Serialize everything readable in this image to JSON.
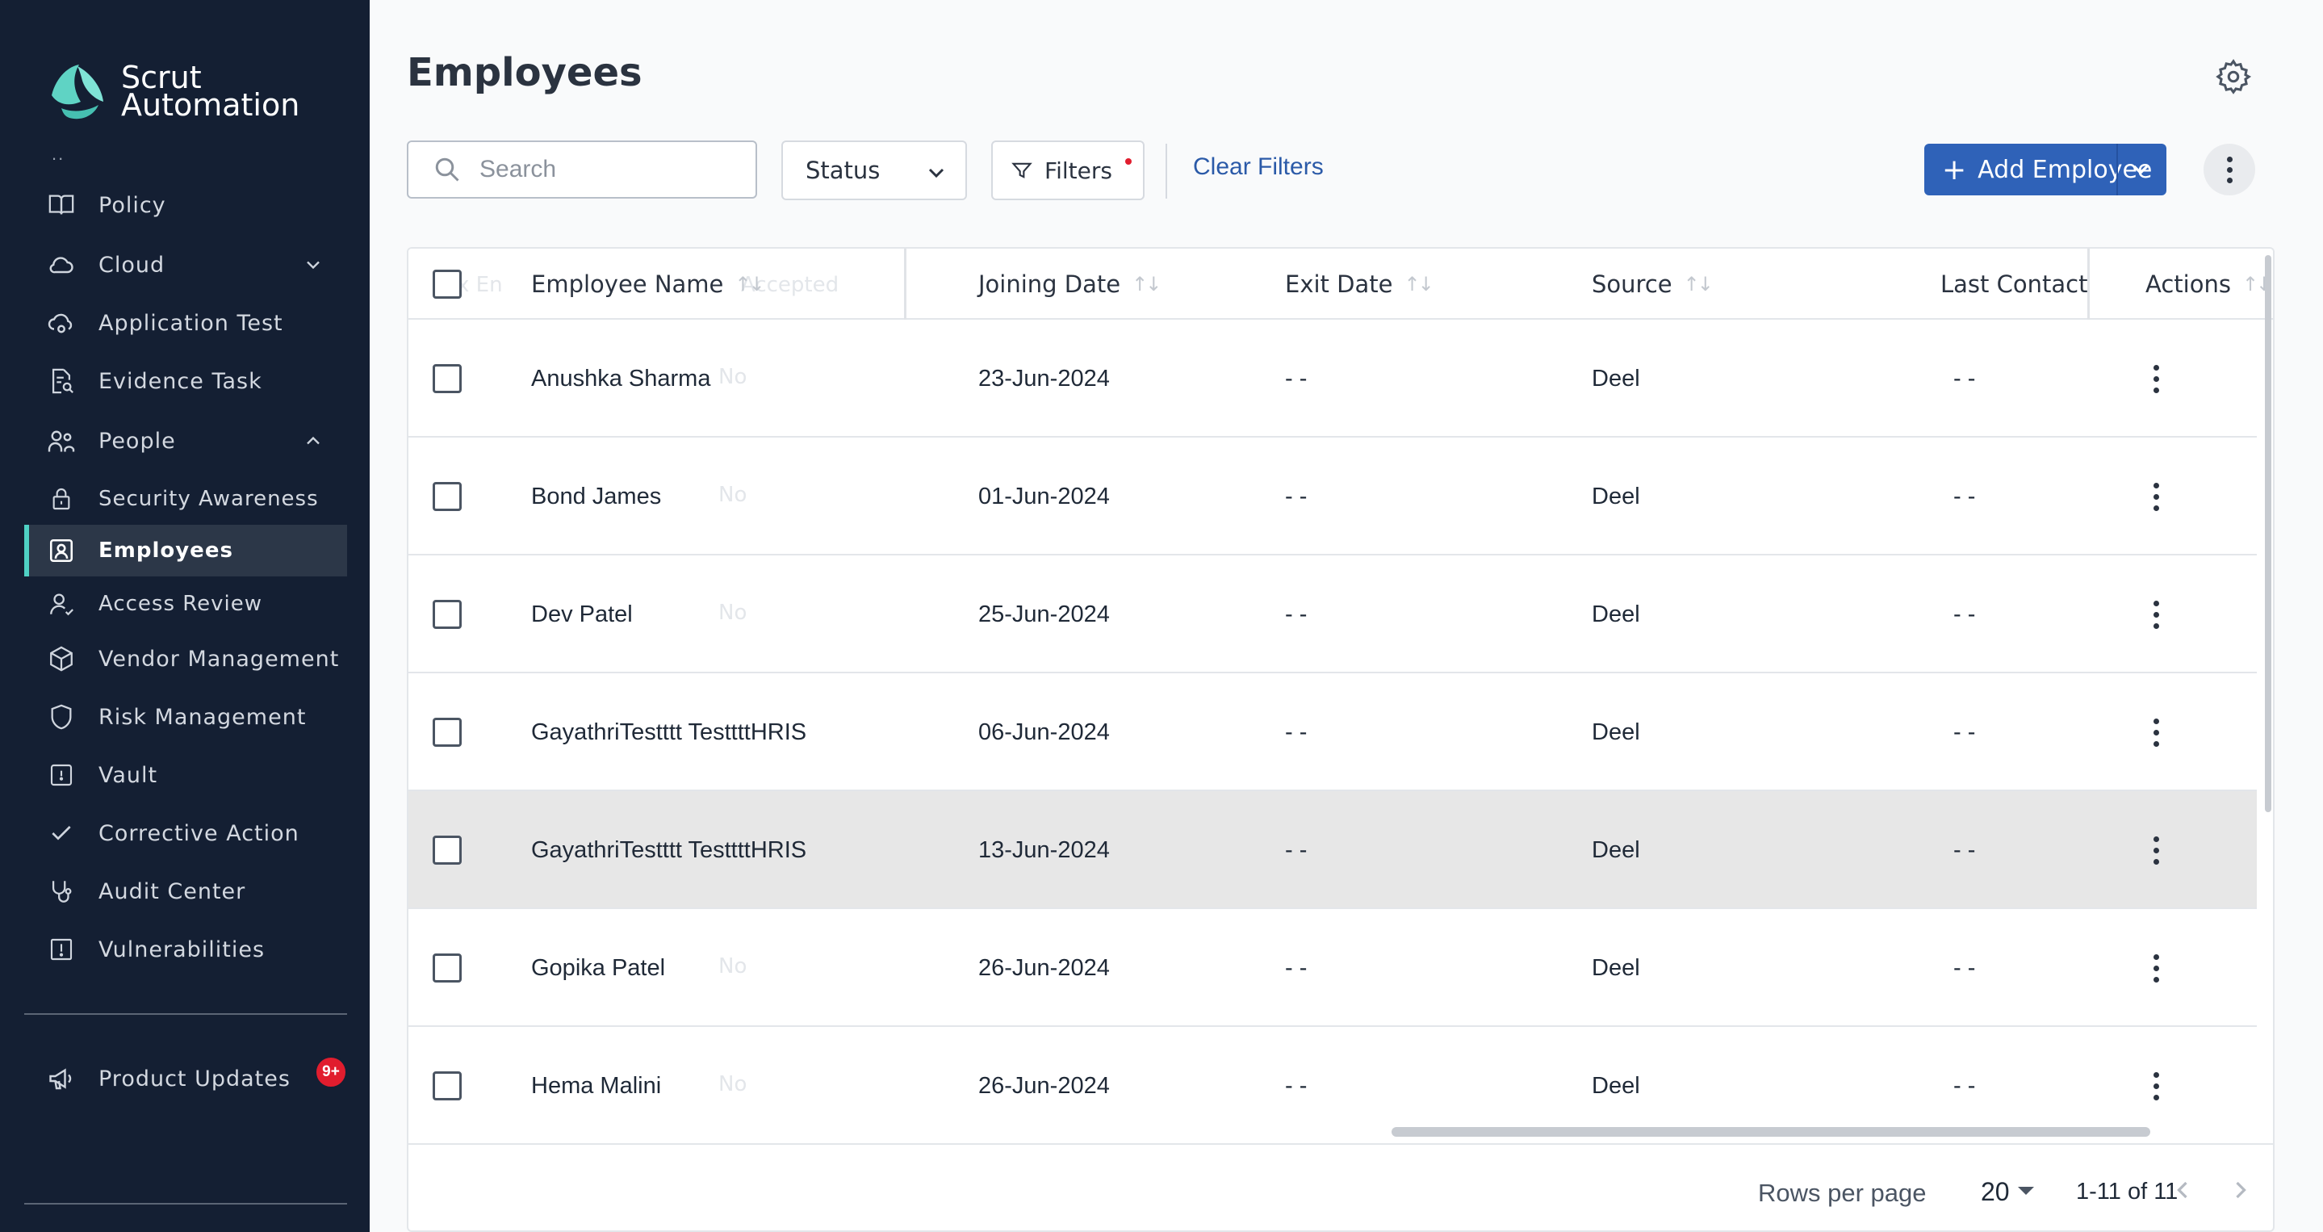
{
  "brand": {
    "line1": "Scrut",
    "line2": "Automation",
    "accent": "#4fd1c5"
  },
  "sidebar": {
    "ellipsis": "..",
    "items": [
      {
        "label": "Policy",
        "icon": "book-icon"
      },
      {
        "label": "Cloud",
        "icon": "cloud-icon",
        "expand": "chevron-down"
      },
      {
        "label": "Application Test",
        "icon": "cloud-gear-icon"
      },
      {
        "label": "Evidence Task",
        "icon": "document-search-icon"
      },
      {
        "label": "People",
        "icon": "people-icon",
        "expand": "chevron-up"
      },
      {
        "label": "Security Awareness",
        "icon": "lock-icon"
      },
      {
        "label": "Employees",
        "icon": "user-badge-icon",
        "active": true
      },
      {
        "label": "Access Review",
        "icon": "user-check-icon"
      },
      {
        "label": "Vendor Management",
        "icon": "cube-icon"
      },
      {
        "label": "Risk Management",
        "icon": "shield-icon"
      },
      {
        "label": "Vault",
        "icon": "vault-icon"
      },
      {
        "label": "Corrective Action",
        "icon": "check-icon"
      },
      {
        "label": "Audit Center",
        "icon": "stethoscope-icon"
      },
      {
        "label": "Vulnerabilities",
        "icon": "alert-square-icon"
      }
    ],
    "product_updates": {
      "label": "Product Updates",
      "badge": "9+"
    }
  },
  "page": {
    "title": "Employees",
    "search_placeholder": "Search",
    "status_label": "Status",
    "filters_label": "Filters",
    "clear_filters": "Clear Filters",
    "add_employee": "Add Employee"
  },
  "table": {
    "columns": {
      "name": "Employee Name",
      "joining": "Joining Date",
      "exit": "Exit Date",
      "source": "Source",
      "last_contact": "Last Contact",
      "actions": "Actions"
    },
    "ghost_header": "Accepted",
    "rows": [
      {
        "name": "Anushka Sharma",
        "joining": "23-Jun-2024",
        "exit": "- -",
        "source": "Deel",
        "last_contact": "- -",
        "ghost": "No"
      },
      {
        "name": "Bond James",
        "joining": "01-Jun-2024",
        "exit": "- -",
        "source": "Deel",
        "last_contact": "- -",
        "ghost": "No"
      },
      {
        "name": "Dev Patel",
        "joining": "25-Jun-2024",
        "exit": "- -",
        "source": "Deel",
        "last_contact": "- -",
        "ghost": "No"
      },
      {
        "name": "GayathriTestttt TesttttHRIS",
        "joining": "06-Jun-2024",
        "exit": "- -",
        "source": "Deel",
        "last_contact": "- -",
        "ghost": ""
      },
      {
        "name": "GayathriTestttt TesttttHRIS",
        "joining": "13-Jun-2024",
        "exit": "- -",
        "source": "Deel",
        "last_contact": "- -",
        "ghost": ""
      },
      {
        "name": "Gopika Patel",
        "joining": "26-Jun-2024",
        "exit": "- -",
        "source": "Deel",
        "last_contact": "- -",
        "ghost": "No"
      },
      {
        "name": "Hema Malini",
        "joining": "26-Jun-2024",
        "exit": "- -",
        "source": "Deel",
        "last_contact": "- -",
        "ghost": "No"
      }
    ]
  },
  "footer": {
    "rows_per_page_label": "Rows per page",
    "rows_per_page": "20",
    "range": "1-11 of 11"
  }
}
